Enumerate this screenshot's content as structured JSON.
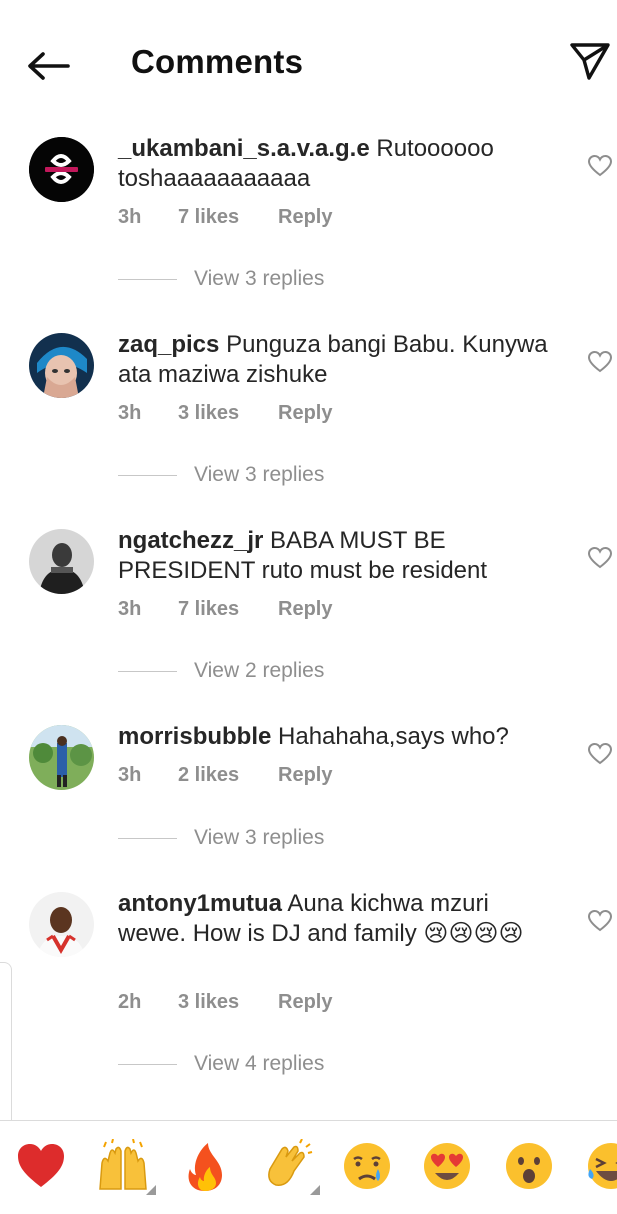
{
  "header": {
    "title": "Comments"
  },
  "comments": [
    {
      "username": "_ukambani_s.a.v.a.g.e",
      "text": "Rutoooooo toshaaaaaaaaaaa",
      "time": "3h",
      "likes": "7 likes",
      "reply": "Reply",
      "replies": "View 3 replies",
      "avatar": "logo-avatar"
    },
    {
      "username": "zaq_pics",
      "text": "Punguza bangi Babu. Kunywa ata maziwa zishuke",
      "time": "3h",
      "likes": "3 likes",
      "reply": "Reply",
      "replies": "View 3 replies",
      "avatar": "photo-avatar"
    },
    {
      "username": "ngatchezz_jr",
      "text": "BABA MUST BE PRESIDENT ruto must be resident",
      "time": "3h",
      "likes": "7 likes",
      "reply": "Reply",
      "replies": "View 2 replies",
      "avatar": "photo-avatar"
    },
    {
      "username": "morrisbubble",
      "text": "Hahahaha,says who?",
      "time": "3h",
      "likes": "2 likes",
      "reply": "Reply",
      "replies": "View 3 replies",
      "avatar": "photo-avatar"
    },
    {
      "username": "antony1mutua",
      "text": "Auna kichwa mzuri wewe. How is DJ and family 😢😢😢😢",
      "time": "2h",
      "likes": "3 likes",
      "reply": "Reply",
      "replies": "View 4 replies",
      "avatar": "photo-avatar"
    }
  ],
  "emoji_bar": [
    "red-heart",
    "raising-hands",
    "fire",
    "clapping-hands",
    "crying-face",
    "heart-eyes-face",
    "surprised-face",
    "laughing-face"
  ],
  "colors": {
    "text": "#262626",
    "meta": "#8e8e8e",
    "divider": "#dbdbdb"
  }
}
